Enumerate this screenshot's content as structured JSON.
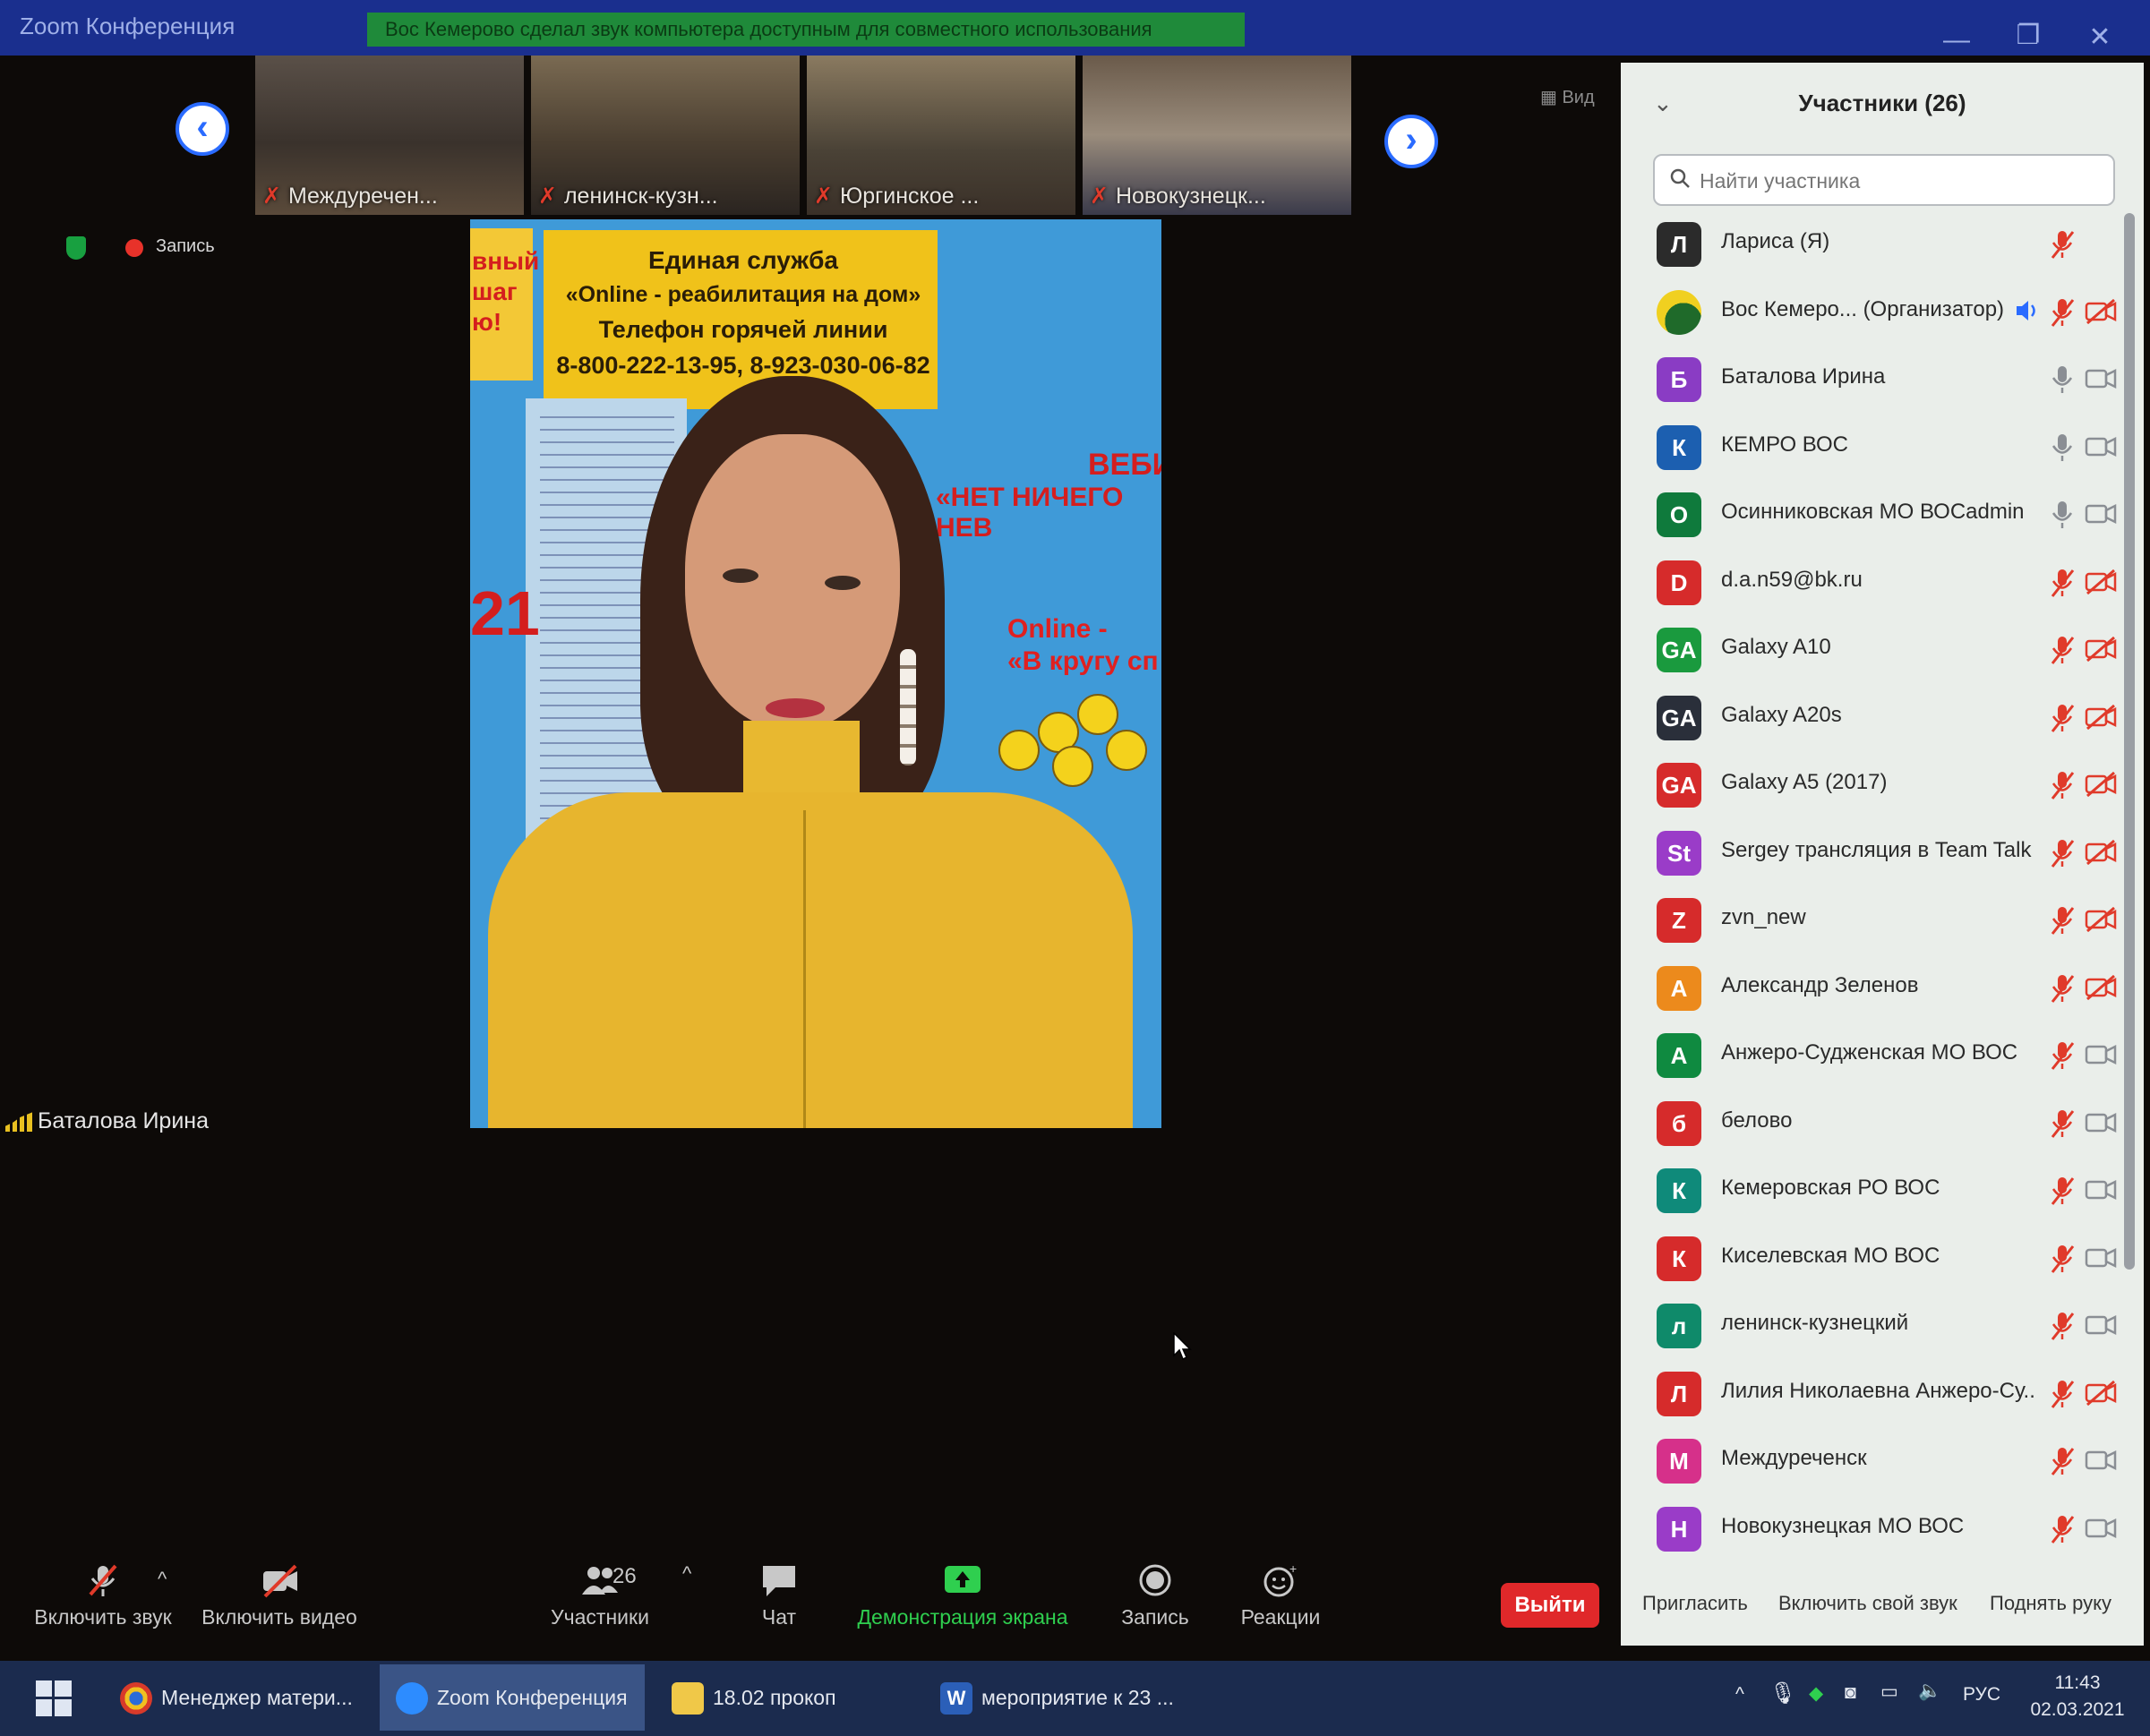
{
  "window": {
    "title": "Zoom Конференция",
    "banner": "Вос Кемерово сделал звук компьютера доступным для совместного использования",
    "controls": [
      "—",
      "❐",
      "✕"
    ]
  },
  "thumbnails": [
    {
      "label": "Междуречен...",
      "muted": true
    },
    {
      "label": "ленинск-кузн...",
      "muted": true
    },
    {
      "label": "Юргинское ...",
      "muted": true
    },
    {
      "label": "Новокузнецк...",
      "muted": true
    }
  ],
  "view_button": "Вид",
  "status": {
    "recording_label": "Запись"
  },
  "main_video": {
    "board_lines": [
      "Единая служба",
      "«Online - реабилитация на дом»",
      "Телефон горячей линии",
      "8-800-222-13-95, 8-923-030-06-82"
    ],
    "left_text": [
      "вный",
      "шаг",
      "ю!"
    ],
    "year": "21",
    "right_lines": [
      "ВЕБИН",
      "«НЕТ НИЧЕГО НЕВ"
    ],
    "right_online": [
      "Online -",
      "«В кругу сп"
    ],
    "speaker_name": "Баталова Ирина"
  },
  "toolbar": {
    "unmute": "Включить звук",
    "start_video": "Включить видео",
    "participants": "Участники",
    "participants_count": "26",
    "chat": "Чат",
    "share": "Демонстрация экрана",
    "record": "Запись",
    "reactions": "Реакции",
    "leave": "Выйти"
  },
  "panel": {
    "title": "Участники (26)",
    "search_placeholder": "Найти участника",
    "participants": [
      {
        "initials": "Л",
        "name": "Лариса (Я)",
        "color": "#2b2b2b",
        "mic": "muted",
        "cam": "none"
      },
      {
        "initials": "",
        "name": "Вос Кемеро... (Организатор)",
        "color": "#1f6a2a",
        "mic": "muted",
        "cam": "off",
        "speaking": true
      },
      {
        "initials": "Б",
        "name": "Баталова Ирина",
        "color": "#8a3cc4",
        "mic": "on",
        "cam": "on"
      },
      {
        "initials": "К",
        "name": "КЕМРО ВОС",
        "color": "#1c5fb0",
        "mic": "on",
        "cam": "on"
      },
      {
        "initials": "О",
        "name": "Осинниковская МО ВОСadmin",
        "color": "#0f7a3c",
        "mic": "on",
        "cam": "on"
      },
      {
        "initials": "D",
        "name": "d.a.n59@bk.ru",
        "color": "#d62b2b",
        "mic": "muted",
        "cam": "off"
      },
      {
        "initials": "GA",
        "name": "Galaxy A10",
        "color": "#1a9a3e",
        "mic": "muted",
        "cam": "off"
      },
      {
        "initials": "GA",
        "name": "Galaxy A20s",
        "color": "#2a2f3a",
        "mic": "muted",
        "cam": "off"
      },
      {
        "initials": "GA",
        "name": "Galaxy A5 (2017)",
        "color": "#d62b2b",
        "mic": "muted",
        "cam": "off"
      },
      {
        "initials": "St",
        "name": "Sergey трансляция в Team Talk",
        "color": "#9a3cc8",
        "mic": "muted",
        "cam": "off"
      },
      {
        "initials": "Z",
        "name": "zvn_new",
        "color": "#d62b2b",
        "mic": "muted",
        "cam": "off"
      },
      {
        "initials": "А",
        "name": "Александр Зеленов",
        "color": "#ec8a1c",
        "mic": "muted",
        "cam": "off"
      },
      {
        "initials": "А",
        "name": "Анжеро-Судженская МО ВОС",
        "color": "#0f8a40",
        "mic": "muted",
        "cam": "on"
      },
      {
        "initials": "б",
        "name": "белово",
        "color": "#d62b2b",
        "mic": "muted",
        "cam": "on"
      },
      {
        "initials": "К",
        "name": "Кемеровская РО ВОС",
        "color": "#0f8a7a",
        "mic": "muted",
        "cam": "on"
      },
      {
        "initials": "К",
        "name": "Киселевская МО ВОС",
        "color": "#d62b2b",
        "mic": "muted",
        "cam": "on"
      },
      {
        "initials": "л",
        "name": "ленинск-кузнецкий",
        "color": "#0f8a6a",
        "mic": "muted",
        "cam": "on"
      },
      {
        "initials": "Л",
        "name": "Лилия Николаевна Анжеро-Су...",
        "color": "#d62b2b",
        "mic": "muted",
        "cam": "off"
      },
      {
        "initials": "М",
        "name": "Междуреченск",
        "color": "#d6308a",
        "mic": "muted",
        "cam": "on"
      },
      {
        "initials": "Н",
        "name": "Новокузнецкая МО ВОС",
        "color": "#9a3cc8",
        "mic": "muted",
        "cam": "on"
      }
    ],
    "invite": "Пригласить",
    "unmute_me": "Включить свой звук",
    "raise_hand": "Поднять руку"
  },
  "taskbar": {
    "items": [
      {
        "label": "Менеджер матери...",
        "icon": "chrome-icon"
      },
      {
        "label": "Zoom Конференция",
        "icon": "zoom-icon",
        "active": true
      },
      {
        "label": "18.02 прокоп",
        "icon": "folder-icon"
      },
      {
        "label": "мероприятие к 23 ...",
        "icon": "word-icon"
      }
    ],
    "lang": "РУС",
    "time": "11:43",
    "date": "02.03.2021"
  },
  "colors": {
    "accent_blue": "#2a6bff",
    "leave_red": "#e0282a",
    "share_green": "#2fcf4f",
    "muted_red": "#e03a2a"
  }
}
